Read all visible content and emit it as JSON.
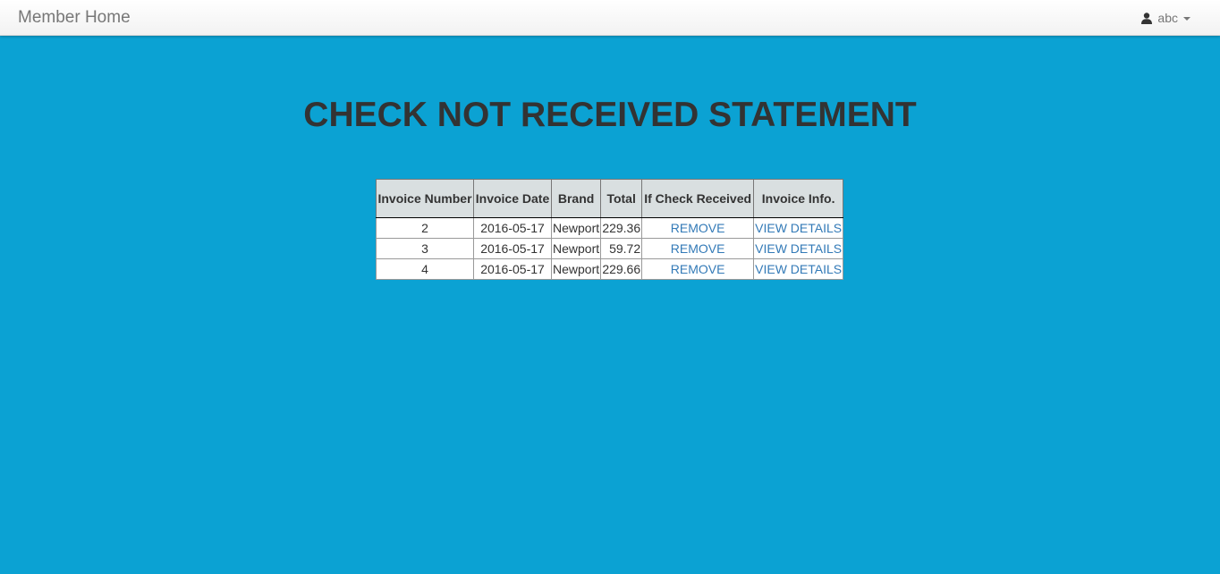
{
  "navbar": {
    "brand": "Member Home",
    "user": "abc",
    "user_icon": "user-icon"
  },
  "page": {
    "title": "CHECK NOT RECEIVED STATEMENT"
  },
  "table": {
    "headers": [
      "Invoice Number",
      "Invoice Date",
      "Brand",
      "Total",
      "If Check Received",
      "Invoice Info."
    ],
    "rows": [
      {
        "invoice_number": "2",
        "invoice_date": "2016-05-17",
        "brand": "Newport",
        "total": "229.36",
        "action": "REMOVE",
        "info": "VIEW DETAILS"
      },
      {
        "invoice_number": "3",
        "invoice_date": "2016-05-17",
        "brand": "Newport",
        "total": "59.72",
        "action": "REMOVE",
        "info": "VIEW DETAILS"
      },
      {
        "invoice_number": "4",
        "invoice_date": "2016-05-17",
        "brand": "Newport",
        "total": "229.66",
        "action": "REMOVE",
        "info": "VIEW DETAILS"
      }
    ]
  },
  "colors": {
    "background": "#0ba2d3",
    "link": "#337ab7",
    "header_bg": "#d9dfe0"
  }
}
